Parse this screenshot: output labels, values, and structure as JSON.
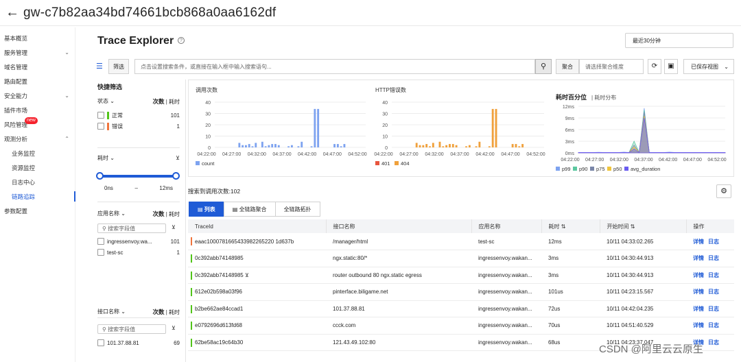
{
  "header": {
    "back": "←",
    "title": "gw-c7b82aa34bd74661bcb868a0aa6162df"
  },
  "sidebar": {
    "items": [
      {
        "label": "基本概览",
        "chevron": false,
        "sub": false
      },
      {
        "label": "服务管理",
        "chevron": true,
        "sub": false
      },
      {
        "label": "域名管理",
        "chevron": false,
        "sub": false
      },
      {
        "label": "路由配置",
        "chevron": false,
        "sub": false
      },
      {
        "label": "安全能力",
        "chevron": true,
        "sub": false
      },
      {
        "label": "插件市场",
        "chevron": false,
        "sub": false
      },
      {
        "label": "风险管理",
        "chevron": false,
        "sub": false,
        "badge": "new"
      },
      {
        "label": "观测分析",
        "chevron": true,
        "sub": false,
        "open": true
      },
      {
        "label": "业务监控",
        "chevron": false,
        "sub": true
      },
      {
        "label": "资源监控",
        "chevron": false,
        "sub": true
      },
      {
        "label": "日志中心",
        "chevron": false,
        "sub": true
      },
      {
        "label": "链路追踪",
        "chevron": false,
        "sub": true,
        "active": true
      },
      {
        "label": "参数配置",
        "chevron": false,
        "sub": false
      }
    ]
  },
  "page": {
    "title": "Trace Explorer",
    "time_range": "最近30分钟"
  },
  "filter": {
    "label": "筛选",
    "placeholder": "点击设置搜索条件，或直接在输入框中输入搜索语句...",
    "agg_label": "聚合",
    "agg_placeholder": "请选择聚合维度",
    "saved_view": "已保存视图"
  },
  "quick_filter": {
    "title": "快捷筛选",
    "status": {
      "label": "状态",
      "count_label": "次数",
      "time_label": "耗时",
      "items": [
        {
          "label": "正常",
          "count": "101",
          "color": "#52c41a"
        },
        {
          "label": "错误",
          "count": "1",
          "color": "#f5222d"
        }
      ]
    },
    "latency": {
      "label": "耗时",
      "min": "0ns",
      "sep": "–",
      "max": "12ms"
    },
    "app": {
      "label": "应用名称",
      "count_label": "次数",
      "time_label": "耗时",
      "placeholder": "搜索字段值",
      "items": [
        {
          "label": "ingressenvoy.wa...",
          "count": "101"
        },
        {
          "label": "test-sc",
          "count": "1"
        }
      ]
    },
    "api": {
      "label": "接口名称",
      "count_label": "次数",
      "time_label": "耗时",
      "placeholder": "搜索字段值",
      "items": [
        {
          "label": "101.37.88.81",
          "count": "69"
        }
      ]
    }
  },
  "chart_data": [
    {
      "type": "bar",
      "title": "调用次数",
      "ylim": [
        0,
        40
      ],
      "yticks": [
        "0",
        "10",
        "20",
        "30",
        "40"
      ],
      "xticks": [
        "04:22:00",
        "04:27:00",
        "04:32:00",
        "04:37:00",
        "04:42:00",
        "04:47:00",
        "04:52:00"
      ],
      "series": [
        {
          "name": "count",
          "color": "#7ea3f0",
          "values": [
            0,
            0,
            0,
            0,
            0,
            0,
            0,
            4,
            2,
            2,
            3,
            1,
            4,
            0,
            5,
            1,
            2,
            3,
            3,
            2,
            0,
            0,
            1,
            2,
            0,
            1,
            5,
            0,
            0,
            1,
            34,
            34,
            0,
            0,
            0,
            0,
            3,
            3,
            1,
            3,
            0,
            0,
            0,
            0,
            0,
            0
          ]
        }
      ]
    },
    {
      "type": "bar",
      "title": "HTTP错误数",
      "ylim": [
        0,
        40
      ],
      "yticks": [
        "0",
        "10",
        "20",
        "30",
        "40"
      ],
      "xticks": [
        "04:22:00",
        "04:27:00",
        "04:32:00",
        "04:37:00",
        "04:42:00",
        "04:47:00",
        "04:52:00"
      ],
      "series": [
        {
          "name": "401",
          "color": "#e8553e",
          "values": []
        },
        {
          "name": "404",
          "color": "#f0a13c",
          "values": [
            0,
            0,
            0,
            0,
            0,
            0,
            0,
            4,
            2,
            2,
            3,
            1,
            4,
            0,
            5,
            1,
            2,
            3,
            3,
            2,
            0,
            0,
            1,
            2,
            0,
            1,
            5,
            0,
            0,
            1,
            34,
            34,
            0,
            0,
            0,
            0,
            3,
            3,
            1,
            3,
            0,
            0,
            0,
            0,
            0,
            0
          ]
        }
      ]
    },
    {
      "type": "area",
      "title": "耗时百分位",
      "subtitle": "耗时分布",
      "ylim": [
        0,
        12
      ],
      "yticks": [
        "0ms",
        "3ms",
        "6ms",
        "9ms",
        "12ms"
      ],
      "xticks": [
        "04:22:00",
        "04:27:00",
        "04:32:00",
        "04:37:00",
        "04:42:00",
        "04:47:00",
        "04:52:00"
      ],
      "series": [
        {
          "name": "p99",
          "color": "#7ea3f0",
          "values": [
            0.1,
            0.1,
            0.1,
            0.1,
            0.15,
            0.1,
            0.1,
            0.1,
            0.1,
            0.2,
            0.1,
            0.4,
            0.1,
            11.5,
            0.1,
            0.1,
            0.1,
            0.1,
            0.2,
            0.1,
            0.1,
            0.1,
            0.1,
            0.1,
            0.1,
            0.1,
            0.1,
            0.1,
            0.1,
            0.1
          ]
        },
        {
          "name": "p90",
          "color": "#5cc8a0",
          "values": [
            0.1,
            0.1,
            0.1,
            0.1,
            0.1,
            0.1,
            0.1,
            0.1,
            0.1,
            0.1,
            0.1,
            3.0,
            0.1,
            11.0,
            0.1,
            0.1,
            0.1,
            0.1,
            0.1,
            0.1,
            0.1,
            0.1,
            0.1,
            0.1,
            0.1,
            0.1,
            0.1,
            0.1,
            0.1,
            0.1
          ]
        },
        {
          "name": "p75",
          "color": "#7a86a8",
          "values": [
            0.1,
            0.1,
            0.1,
            0.1,
            0.1,
            0.1,
            0.1,
            0.1,
            0.1,
            0.1,
            0.1,
            2.0,
            0.1,
            10.5,
            0.1,
            0.1,
            0.1,
            0.1,
            0.1,
            0.1,
            0.1,
            0.1,
            0.1,
            0.1,
            0.1,
            0.1,
            0.1,
            0.1,
            0.1,
            0.1
          ]
        },
        {
          "name": "p50",
          "color": "#f0c53c",
          "values": [
            0.1,
            0.1,
            0.1,
            0.1,
            0.1,
            0.1,
            0.1,
            0.1,
            0.1,
            0.1,
            0.1,
            1.5,
            0.1,
            9.5,
            0.1,
            0.1,
            0.1,
            0.1,
            0.1,
            0.1,
            0.1,
            0.1,
            0.1,
            0.1,
            0.1,
            0.1,
            0.1,
            0.1,
            0.1,
            0.1
          ]
        },
        {
          "name": "avg_duration",
          "color": "#6a5cf0",
          "values": [
            0.1,
            0.1,
            0.1,
            0.1,
            0.1,
            0.1,
            0.1,
            0.1,
            0.1,
            0.1,
            0.1,
            1.0,
            0.1,
            9.0,
            0.1,
            0.1,
            0.1,
            0.1,
            0.1,
            0.1,
            0.1,
            0.1,
            0.1,
            0.1,
            0.1,
            0.1,
            0.1,
            0.1,
            0.1,
            0.1
          ]
        }
      ]
    }
  ],
  "table": {
    "title": "搜索到调用次数:102",
    "tabs": [
      "列表",
      "全链路聚合",
      "全链路拓扑"
    ],
    "columns": [
      "TraceId",
      "接口名称",
      "应用名称",
      "耗时",
      "开始时间",
      "操作"
    ],
    "actions": [
      "详情",
      "日志"
    ],
    "rows": [
      {
        "traceid": "eaac1000781665433982265220 1d637b",
        "api": "/manager/html",
        "app": "test-sc",
        "dur": "12ms",
        "time": "10/11 04:33:02.265",
        "color": "#f0743c"
      },
      {
        "traceid": "0c392abb74148985",
        "api": "ngx.static:80/*",
        "app": "ingressenvoy.wakan...",
        "dur": "3ms",
        "time": "10/11 04:30:44.913",
        "color": "#52c41a"
      },
      {
        "traceid": "0c392abb74148985",
        "api": "router outbound 80 ngx.static egress",
        "app": "ingressenvoy.wakan...",
        "dur": "3ms",
        "time": "10/11 04:30:44.913",
        "color": "#52c41a"
      },
      {
        "traceid": "612e02b598a03f96",
        "api": "pinterface.biligame.net",
        "app": "ingressenvoy.wakan...",
        "dur": "101us",
        "time": "10/11 04:23:15.567",
        "color": "#52c41a"
      },
      {
        "traceid": "b2be662ae84ccad1",
        "api": "101.37.88.81",
        "app": "ingressenvoy.wakan...",
        "dur": "72us",
        "time": "10/11 04:42:04.235",
        "color": "#52c41a"
      },
      {
        "traceid": "e0792696d613fd68",
        "api": "ccck.com",
        "app": "ingressenvoy.wakan...",
        "dur": "70us",
        "time": "10/11 04:51:40.529",
        "color": "#52c41a"
      },
      {
        "traceid": "62be58ac19c64b30",
        "api": "121.43.49.102:80",
        "app": "ingressenvoy.wakan...",
        "dur": "68us",
        "time": "10/11 04:23:37.047",
        "color": "#52c41a"
      }
    ]
  },
  "watermark": "CSDN @阿里云云原生"
}
